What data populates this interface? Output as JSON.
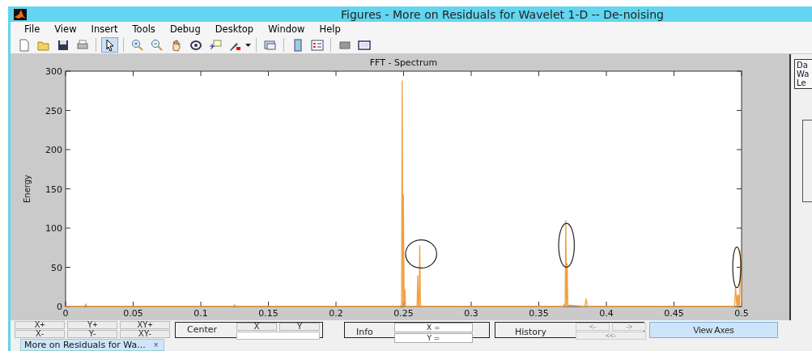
{
  "window": {
    "title": "Figures - More on Residuals for Wavelet 1-D  --  De-noising"
  },
  "menu": [
    "File",
    "View",
    "Insert",
    "Tools",
    "Debug",
    "Desktop",
    "Window",
    "Help"
  ],
  "toolbar": {
    "groups": [
      [
        {
          "selected": false
        },
        {
          "selected": false
        },
        {
          "selected": false
        },
        {
          "selected": false
        }
      ],
      [
        {
          "selected": true
        }
      ],
      [
        {
          "selected": false
        },
        {
          "selected": false
        },
        {
          "selected": false
        },
        {
          "selected": false
        },
        {
          "selected": false
        },
        {
          "selected": false
        }
      ],
      [
        {
          "selected": false
        }
      ],
      [
        {
          "selected": false
        },
        {
          "selected": false
        }
      ],
      [
        {
          "selected": false
        },
        {
          "selected": false
        }
      ]
    ]
  },
  "plot": {
    "title": "FFT - Spectrum",
    "chart_data": {
      "type": "line",
      "ylabel": "Energy",
      "xlim": [
        0,
        0.5
      ],
      "ylim": [
        0,
        300
      ],
      "xticks": [
        0,
        0.05,
        0.1,
        0.15,
        0.2,
        0.25,
        0.3,
        0.35,
        0.4,
        0.45,
        0.5
      ],
      "yticks": [
        0,
        50,
        100,
        150,
        200,
        250,
        300
      ],
      "series": [
        {
          "color": "#f0a040",
          "x": [
            0,
            0.014,
            0.015,
            0.016,
            0.1,
            0.124,
            0.125,
            0.126,
            0.247,
            0.2485,
            0.249,
            0.2495,
            0.2498,
            0.2505,
            0.251,
            0.2515,
            0.26,
            0.2605,
            0.261,
            0.2615,
            0.262,
            0.2625,
            0.27,
            0.368,
            0.369,
            0.3695,
            0.37,
            0.3705,
            0.371,
            0.3715,
            0.372,
            0.384,
            0.385,
            0.386,
            0.494,
            0.495,
            0.4955,
            0.4965,
            0.497,
            0.4975,
            0.498,
            0.4985,
            0.499,
            0.4995,
            0.5
          ],
          "values": [
            0,
            0,
            3,
            0,
            0,
            0,
            2,
            0,
            0,
            2,
            288,
            0,
            143,
            0,
            22,
            0,
            0,
            40,
            0,
            0,
            78,
            0,
            0,
            0,
            3,
            0,
            110,
            0,
            55,
            0,
            2,
            0,
            10,
            0,
            0,
            2,
            25,
            0,
            15,
            0,
            15,
            0,
            40,
            72,
            0
          ]
        }
      ]
    },
    "marks": [
      {
        "kind": "ellipse"
      },
      {
        "kind": "ellipse"
      },
      {
        "kind": "ellipse"
      }
    ]
  },
  "side_panel": {
    "lines": [
      "Da",
      "Wa",
      "Le"
    ]
  },
  "controls": {
    "zoom_buttons": [
      "X+",
      "Y+",
      "XY+",
      "X-",
      "Y-",
      "XY-"
    ],
    "center": {
      "label": "Center",
      "buttons": [
        "X",
        "Y"
      ]
    },
    "info": {
      "label": "Info",
      "fields": [
        "X =",
        "Y ="
      ]
    },
    "history": {
      "label": "History",
      "buttons": [
        {
          "label": "<-",
          "disabled": true
        },
        {
          "label": "->",
          "disabled": true
        },
        {
          "label": "<<-",
          "disabled": true
        }
      ]
    },
    "view_axes": {
      "label": "View Axes",
      "selected": true
    }
  },
  "tab": {
    "label": "More on Residuals for Wa...",
    "close": "×"
  }
}
